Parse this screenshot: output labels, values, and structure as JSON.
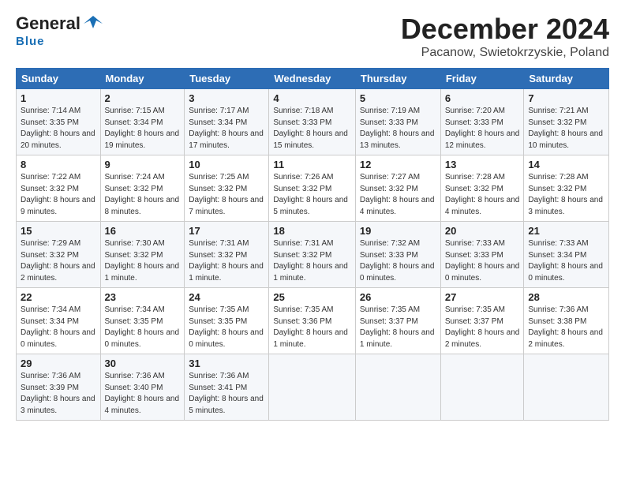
{
  "logo": {
    "general": "General",
    "blue": "Blue"
  },
  "title": "December 2024",
  "subtitle": "Pacanow, Swietokrzyskie, Poland",
  "days_of_week": [
    "Sunday",
    "Monday",
    "Tuesday",
    "Wednesday",
    "Thursday",
    "Friday",
    "Saturday"
  ],
  "weeks": [
    [
      {
        "day": "1",
        "sunrise": "7:14 AM",
        "sunset": "3:35 PM",
        "daylight": "8 hours and 20 minutes."
      },
      {
        "day": "2",
        "sunrise": "7:15 AM",
        "sunset": "3:34 PM",
        "daylight": "8 hours and 19 minutes."
      },
      {
        "day": "3",
        "sunrise": "7:17 AM",
        "sunset": "3:34 PM",
        "daylight": "8 hours and 17 minutes."
      },
      {
        "day": "4",
        "sunrise": "7:18 AM",
        "sunset": "3:33 PM",
        "daylight": "8 hours and 15 minutes."
      },
      {
        "day": "5",
        "sunrise": "7:19 AM",
        "sunset": "3:33 PM",
        "daylight": "8 hours and 13 minutes."
      },
      {
        "day": "6",
        "sunrise": "7:20 AM",
        "sunset": "3:33 PM",
        "daylight": "8 hours and 12 minutes."
      },
      {
        "day": "7",
        "sunrise": "7:21 AM",
        "sunset": "3:32 PM",
        "daylight": "8 hours and 10 minutes."
      }
    ],
    [
      {
        "day": "8",
        "sunrise": "7:22 AM",
        "sunset": "3:32 PM",
        "daylight": "8 hours and 9 minutes."
      },
      {
        "day": "9",
        "sunrise": "7:24 AM",
        "sunset": "3:32 PM",
        "daylight": "8 hours and 8 minutes."
      },
      {
        "day": "10",
        "sunrise": "7:25 AM",
        "sunset": "3:32 PM",
        "daylight": "8 hours and 7 minutes."
      },
      {
        "day": "11",
        "sunrise": "7:26 AM",
        "sunset": "3:32 PM",
        "daylight": "8 hours and 5 minutes."
      },
      {
        "day": "12",
        "sunrise": "7:27 AM",
        "sunset": "3:32 PM",
        "daylight": "8 hours and 4 minutes."
      },
      {
        "day": "13",
        "sunrise": "7:28 AM",
        "sunset": "3:32 PM",
        "daylight": "8 hours and 4 minutes."
      },
      {
        "day": "14",
        "sunrise": "7:28 AM",
        "sunset": "3:32 PM",
        "daylight": "8 hours and 3 minutes."
      }
    ],
    [
      {
        "day": "15",
        "sunrise": "7:29 AM",
        "sunset": "3:32 PM",
        "daylight": "8 hours and 2 minutes."
      },
      {
        "day": "16",
        "sunrise": "7:30 AM",
        "sunset": "3:32 PM",
        "daylight": "8 hours and 1 minute."
      },
      {
        "day": "17",
        "sunrise": "7:31 AM",
        "sunset": "3:32 PM",
        "daylight": "8 hours and 1 minute."
      },
      {
        "day": "18",
        "sunrise": "7:31 AM",
        "sunset": "3:32 PM",
        "daylight": "8 hours and 1 minute."
      },
      {
        "day": "19",
        "sunrise": "7:32 AM",
        "sunset": "3:33 PM",
        "daylight": "8 hours and 0 minutes."
      },
      {
        "day": "20",
        "sunrise": "7:33 AM",
        "sunset": "3:33 PM",
        "daylight": "8 hours and 0 minutes."
      },
      {
        "day": "21",
        "sunrise": "7:33 AM",
        "sunset": "3:34 PM",
        "daylight": "8 hours and 0 minutes."
      }
    ],
    [
      {
        "day": "22",
        "sunrise": "7:34 AM",
        "sunset": "3:34 PM",
        "daylight": "8 hours and 0 minutes."
      },
      {
        "day": "23",
        "sunrise": "7:34 AM",
        "sunset": "3:35 PM",
        "daylight": "8 hours and 0 minutes."
      },
      {
        "day": "24",
        "sunrise": "7:35 AM",
        "sunset": "3:35 PM",
        "daylight": "8 hours and 0 minutes."
      },
      {
        "day": "25",
        "sunrise": "7:35 AM",
        "sunset": "3:36 PM",
        "daylight": "8 hours and 1 minute."
      },
      {
        "day": "26",
        "sunrise": "7:35 AM",
        "sunset": "3:37 PM",
        "daylight": "8 hours and 1 minute."
      },
      {
        "day": "27",
        "sunrise": "7:35 AM",
        "sunset": "3:37 PM",
        "daylight": "8 hours and 2 minutes."
      },
      {
        "day": "28",
        "sunrise": "7:36 AM",
        "sunset": "3:38 PM",
        "daylight": "8 hours and 2 minutes."
      }
    ],
    [
      {
        "day": "29",
        "sunrise": "7:36 AM",
        "sunset": "3:39 PM",
        "daylight": "8 hours and 3 minutes."
      },
      {
        "day": "30",
        "sunrise": "7:36 AM",
        "sunset": "3:40 PM",
        "daylight": "8 hours and 4 minutes."
      },
      {
        "day": "31",
        "sunrise": "7:36 AM",
        "sunset": "3:41 PM",
        "daylight": "8 hours and 5 minutes."
      },
      null,
      null,
      null,
      null
    ]
  ]
}
